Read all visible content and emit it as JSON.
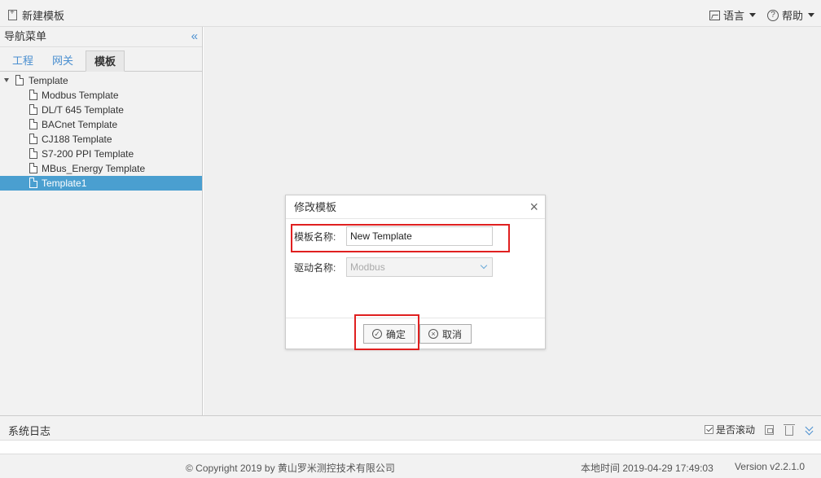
{
  "toolbar": {
    "new_template": "新建模板",
    "language": "语言",
    "help": "帮助"
  },
  "sidebar": {
    "title": "导航菜单",
    "tabs": [
      "工程",
      "网关",
      "模板"
    ],
    "active_tab": "模板",
    "tree_root": "Template",
    "tree_items": [
      "Modbus Template",
      "DL/T 645 Template",
      "BACnet Template",
      "CJ188 Template",
      "S7-200 PPI Template",
      "MBus_Energy Template",
      "Template1"
    ],
    "selected_item": "Template1"
  },
  "dialog": {
    "title": "修改模板",
    "name_label": "模板名称:",
    "name_value": "New Template",
    "driver_label": "驱动名称:",
    "driver_value": "Modbus",
    "ok_label": "确定",
    "cancel_label": "取消"
  },
  "log": {
    "title": "系统日志",
    "autoscroll_label": "是否滚动",
    "autoscroll_checked": true
  },
  "status": {
    "copyright": "© Copyright 2019 by 黄山罗米测控技术有限公司",
    "local_time": "本地时间 2019-04-29 17:49:03",
    "version": "Version v2.2.1.0"
  },
  "colors": {
    "accent": "#4a9fd0",
    "highlight": "#e02020"
  }
}
